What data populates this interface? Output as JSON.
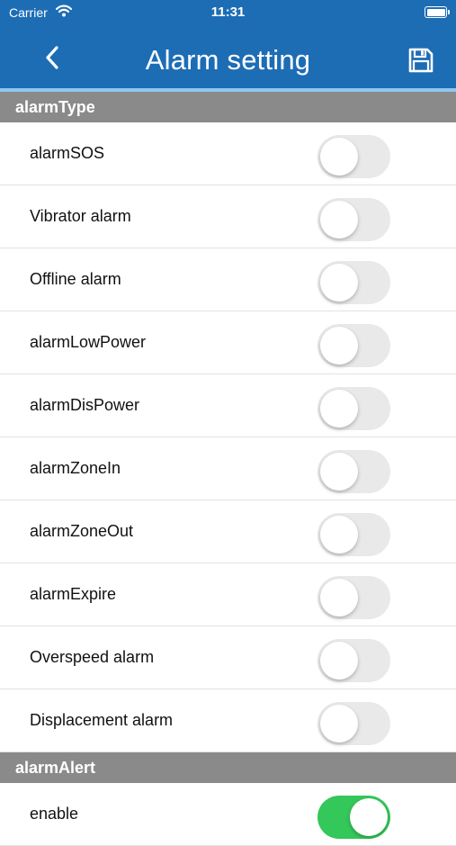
{
  "status_bar": {
    "carrier": "Carrier",
    "time": "11:31"
  },
  "nav": {
    "title": "Alarm setting",
    "back_icon": "chevron-left-icon",
    "save_icon": "floppy-disk-icon"
  },
  "colors": {
    "nav_bg": "#1d6db5",
    "section_bg": "#8a8a8a",
    "toggle_on": "#34c759",
    "toggle_off": "#e9e9ea"
  },
  "sections": [
    {
      "title": "alarmType",
      "items": [
        {
          "label": "alarmSOS",
          "enabled": false
        },
        {
          "label": "Vibrator alarm",
          "enabled": false
        },
        {
          "label": "Offline alarm",
          "enabled": false
        },
        {
          "label": "alarmLowPower",
          "enabled": false
        },
        {
          "label": "alarmDisPower",
          "enabled": false
        },
        {
          "label": "alarmZoneIn",
          "enabled": false
        },
        {
          "label": "alarmZoneOut",
          "enabled": false
        },
        {
          "label": "alarmExpire",
          "enabled": false
        },
        {
          "label": "Overspeed alarm",
          "enabled": false
        },
        {
          "label": "Displacement alarm",
          "enabled": false
        }
      ]
    },
    {
      "title": "alarmAlert",
      "items": [
        {
          "label": "enable",
          "enabled": true
        }
      ]
    }
  ]
}
